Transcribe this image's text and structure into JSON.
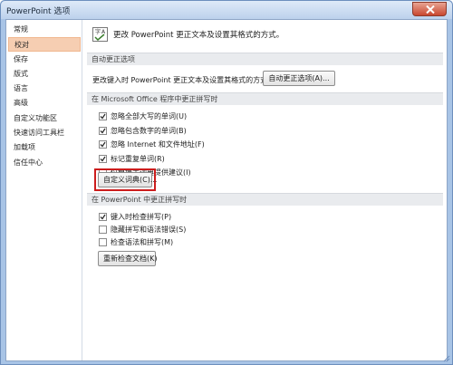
{
  "window": {
    "title": "PowerPoint 选项"
  },
  "nav": {
    "items": [
      {
        "label": "常规",
        "selected": false
      },
      {
        "label": "校对",
        "selected": true
      },
      {
        "label": "保存",
        "selected": false
      },
      {
        "label": "版式",
        "selected": false
      },
      {
        "label": "语言",
        "selected": false
      },
      {
        "label": "高级",
        "selected": false
      },
      {
        "label": "自定义功能区",
        "selected": false
      },
      {
        "label": "快速访问工具栏",
        "selected": false
      },
      {
        "label": "加载项",
        "selected": false
      },
      {
        "label": "信任中心",
        "selected": false
      }
    ]
  },
  "header": {
    "text": "更改 PowerPoint 更正文本及设置其格式的方式。"
  },
  "autocorrect": {
    "section_title": "自动更正选项",
    "description": "更改键入时 PowerPoint 更正文本及设置其格式的方式:",
    "button_label": "自动更正选项(A)..."
  },
  "office_spelling": {
    "section_title": "在 Microsoft Office 程序中更正拼写时",
    "checkboxes": [
      {
        "label": "忽略全部大写的单词(U)",
        "checked": true
      },
      {
        "label": "忽略包含数字的单词(B)",
        "checked": true
      },
      {
        "label": "忽略 Internet 和文件地址(F)",
        "checked": true
      },
      {
        "label": "标记重复单词(R)",
        "checked": true
      },
      {
        "label": "仅根据主词典提供建议(I)",
        "checked": false
      }
    ],
    "custom_dict_button": "自定义词典(C)..."
  },
  "ppt_spelling": {
    "section_title": "在 PowerPoint 中更正拼写时",
    "checkboxes": [
      {
        "label": "键入时检查拼写(P)",
        "checked": true
      },
      {
        "label": "隐藏拼写和语法错误(S)",
        "checked": false
      },
      {
        "label": "检查语法和拼写(M)",
        "checked": false
      }
    ],
    "recheck_button": "重新检查文档(K)"
  },
  "colors": {
    "highlight": "#cc1d1d",
    "nav_selected": "#f6ceb2"
  }
}
